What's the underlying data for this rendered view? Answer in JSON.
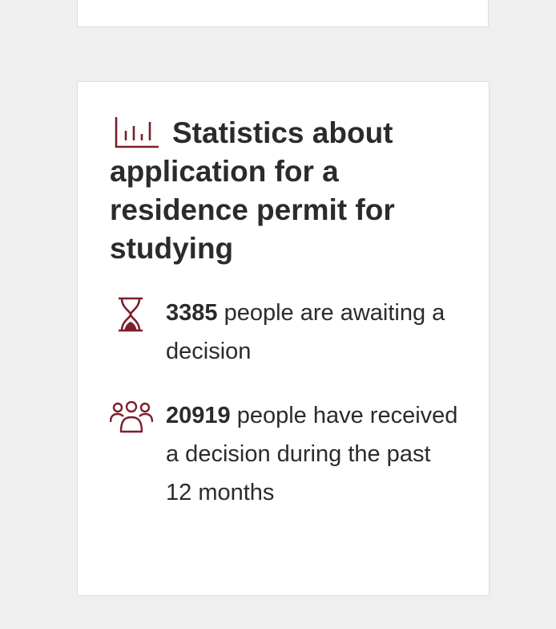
{
  "card": {
    "title": "Statistics about application for a residence permit for studying",
    "title_icon": "bar-chart-icon",
    "stats": [
      {
        "icon": "hourglass-icon",
        "number": "3385",
        "text": "people are awaiting a decision"
      },
      {
        "icon": "people-group-icon",
        "number": "20919",
        "text": "people have received a decision during the past 12 months"
      }
    ]
  },
  "colors": {
    "accent": "#7b1f2b",
    "text": "#2b2b2b",
    "background": "#efefef",
    "card": "#ffffff"
  }
}
